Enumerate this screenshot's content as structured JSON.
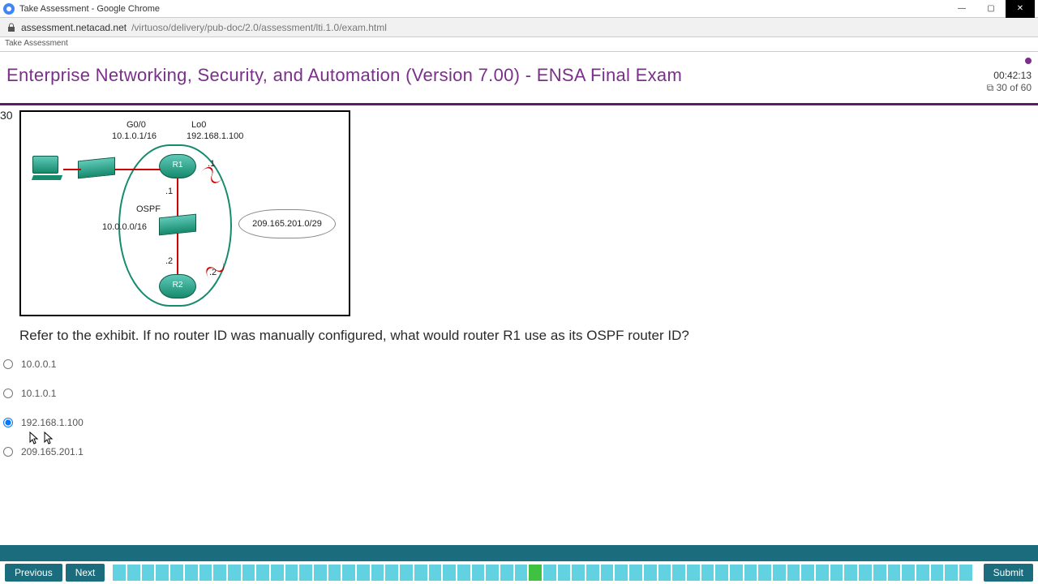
{
  "window": {
    "title": "Take Assessment - Google Chrome",
    "url_host": "assessment.netacad.net",
    "url_path": "/virtuoso/delivery/pub-doc/2.0/assessment/lti.1.0/exam.html"
  },
  "tab_label": "Take Assessment",
  "exam": {
    "title": "Enterprise Networking, Security, and Automation (Version 7.00) - ENSA Final Exam",
    "timer": "00:42:13",
    "progress": "30 of 60"
  },
  "question": {
    "number": "30",
    "text": "Refer to the exhibit. If no router ID was manually configured, what would router R1 use as its OSPF router ID?",
    "selected_index": 2,
    "options": [
      "10.0.0.1",
      "10.1.0.1",
      "192.168.1.100",
      "209.165.201.1"
    ]
  },
  "diagram": {
    "g00_label": "G0/0",
    "g00_ip": "10.1.0.1/16",
    "lo0_label": "Lo0",
    "lo0_ip": "192.168.1.100",
    "r1": "R1",
    "r2": "R2",
    "ospf": "OSPF",
    "ospf_net": "10.0.0.0/16",
    "dot1a": ".1",
    "dot1b": ".1",
    "dot2a": ".2",
    "dot2b": ".2",
    "cloud_net": "209.165.201.0/29"
  },
  "nav": {
    "prev": "Previous",
    "next": "Next",
    "submit": "Submit",
    "total_cells": 60,
    "current_cell": 30
  }
}
